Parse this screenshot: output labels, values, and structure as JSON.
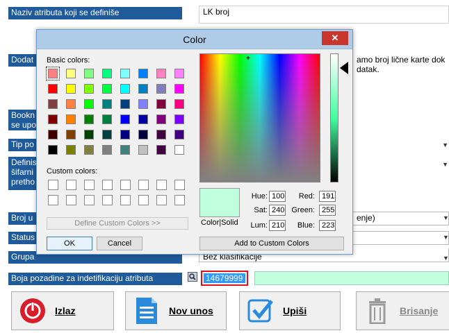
{
  "form": {
    "name_label": "Naziv atributa koji se definiše",
    "name_value": "LK broj",
    "additional_label": "Dodat",
    "additional_value_line1": "amo broj lične karte dok",
    "additional_value_line2": "datak.",
    "bookmark_label_line1": "Bookn",
    "bookmark_label_line2": "se upo",
    "type_label": "Tip po",
    "define_label_line1": "Definis",
    "define_label_line2": "šifarni",
    "define_label_line3": "pretho",
    "number_label": "Broj u",
    "number_value": "enje)",
    "status_label": "Status",
    "group_label": "Grupa",
    "group_value": "Bez klasifikacije",
    "bg_color_label": "Boja pozadine za indetifikaciju atributa",
    "bg_color_value": "14679999",
    "bg_color_preview": "#c1ffdf"
  },
  "buttons": {
    "exit": "Izlaz",
    "new_entry": "Nov unos",
    "save": "Upiši",
    "delete": "Brisanje"
  },
  "dialog": {
    "title": "Color",
    "close_symbol": "✕",
    "basic_colors_label": "Basic colors:",
    "custom_colors_label": "Custom colors:",
    "define_custom_button": "Define Custom Colors >>",
    "ok_button": "OK",
    "cancel_button": "Cancel",
    "color_solid_label": "Color|Solid",
    "add_custom_button": "Add to Custom Colors",
    "hue_label": "Hue:",
    "hue_value": "100",
    "sat_label": "Sat:",
    "sat_value": "240",
    "lum_label": "Lum:",
    "lum_value": "210",
    "red_label": "Red:",
    "red_value": "191",
    "green_label": "Green:",
    "green_value": "255",
    "blue_label": "Blue:",
    "blue_value": "223",
    "preview_color": "#bfffdf",
    "basic_colors": [
      "#ff8080",
      "#ffff80",
      "#80ff80",
      "#00ff80",
      "#80ffff",
      "#0080ff",
      "#ff80c0",
      "#ff80ff",
      "#ff0000",
      "#ffff00",
      "#80ff00",
      "#00ff40",
      "#00ffff",
      "#0080c0",
      "#8080c0",
      "#ff00ff",
      "#804040",
      "#ff8040",
      "#00ff00",
      "#008080",
      "#004080",
      "#8080ff",
      "#800040",
      "#ff0080",
      "#800000",
      "#ff8000",
      "#008000",
      "#008040",
      "#0000ff",
      "#0000a0",
      "#800080",
      "#8000ff",
      "#400000",
      "#804000",
      "#004000",
      "#004040",
      "#000080",
      "#000040",
      "#400040",
      "#400080",
      "#000000",
      "#808000",
      "#808040",
      "#808080",
      "#408080",
      "#c0c0c0",
      "#400040",
      "#ffffff"
    ]
  }
}
